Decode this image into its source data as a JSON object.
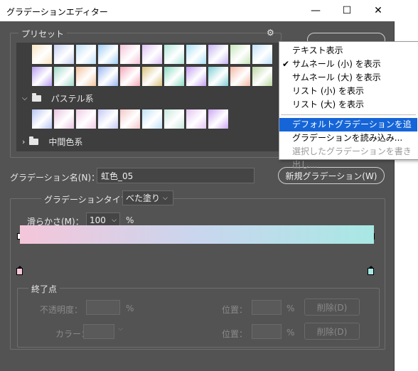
{
  "window": {
    "title": "グラデーションエディター",
    "minimize": "—",
    "maximize": "☐",
    "close": "✕"
  },
  "presets": {
    "label": "プリセット",
    "gear": "⚙",
    "row1": [
      "#f7e3c2",
      "#c6d0f0",
      "#bfe0f7",
      "#9ecdf5",
      "#f4c2d6",
      "#dcbff2",
      "#aee6d9",
      "#a9e0f3",
      "#c6b4f2",
      "#c6e6b9",
      "#bde0f6"
    ],
    "row2": [
      "#b69cf0",
      "#9fd8c8",
      "#f3c59e",
      "#9ab6f2",
      "#f4a7b9",
      "#d9c27a",
      "#8adbc2",
      "#c49ff2",
      "#7fcfd4",
      "#f5b7a2",
      "#b9d7a0"
    ],
    "folder1": "パステル系",
    "pastel": [
      "#b6c4f2",
      "#e8c3e0",
      "#f0cbe6",
      "#c4c8f5",
      "#f3c7c8",
      "#bfe0f5",
      "#c7e7dc",
      "#e3c3f2",
      "#cda6f4"
    ],
    "folder2": "中間色系"
  },
  "context_menu": {
    "items": [
      {
        "label": "テキスト表示",
        "checked": false,
        "highlighted": false,
        "disabled": false
      },
      {
        "label": "サムネール (小) を表示",
        "checked": true,
        "highlighted": false,
        "disabled": false
      },
      {
        "label": "サムネール (大) を表示",
        "checked": false,
        "highlighted": false,
        "disabled": false
      },
      {
        "label": "リスト (小) を表示",
        "checked": false,
        "highlighted": false,
        "disabled": false
      },
      {
        "label": "リスト (大) を表示",
        "checked": false,
        "highlighted": false,
        "disabled": false
      },
      {
        "label": "デフォルトグラデーションを追加...",
        "checked": false,
        "highlighted": true,
        "disabled": false
      },
      {
        "label": "グラデーションを読み込み...",
        "checked": false,
        "highlighted": false,
        "disabled": false
      },
      {
        "label": "選択したグラデーションを書き出し...",
        "checked": false,
        "highlighted": false,
        "disabled": true
      }
    ],
    "check_glyph": "✔"
  },
  "name": {
    "label": "グラデーション名(N)：",
    "value": "虹色_05",
    "new_button": "新規グラデーション(W)"
  },
  "type": {
    "label": "グラデーションタイプ：",
    "value": "べた塗り"
  },
  "smoothness": {
    "label": "滑らかさ(M)：",
    "value": "100",
    "unit": "%"
  },
  "gradient": {
    "start_color": "#f5c6da",
    "mid_color": "#c9d6ee",
    "end_color": "#a8e8e4"
  },
  "stops": {
    "label": "終了点",
    "opacity_label": "不透明度：",
    "opacity_unit": "%",
    "color_label": "カラー：",
    "location_label": "位置：",
    "location_unit": "%",
    "delete_button": "削除(D)"
  }
}
